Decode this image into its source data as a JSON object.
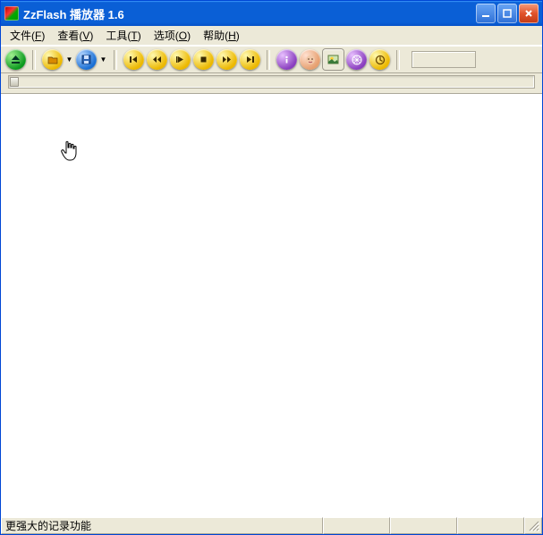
{
  "title": "ZzFlash 播放器 1.6",
  "menu": {
    "file": {
      "label": "文件",
      "hotkey": "F"
    },
    "view": {
      "label": "查看",
      "hotkey": "V"
    },
    "tools": {
      "label": "工具",
      "hotkey": "T"
    },
    "options": {
      "label": "选项",
      "hotkey": "O"
    },
    "help": {
      "label": "帮助",
      "hotkey": "H"
    }
  },
  "toolbar": {
    "eject": "eject",
    "open": "open-folder",
    "save": "save",
    "first": "first-frame",
    "prev": "prev-frame",
    "play": "play",
    "stop": "stop",
    "next": "next-frame",
    "last": "last-frame",
    "info": "info",
    "face": "face",
    "snap": "snapshot",
    "globe": "globe",
    "misc": "misc"
  },
  "status": {
    "message": "更强大的记录功能"
  }
}
